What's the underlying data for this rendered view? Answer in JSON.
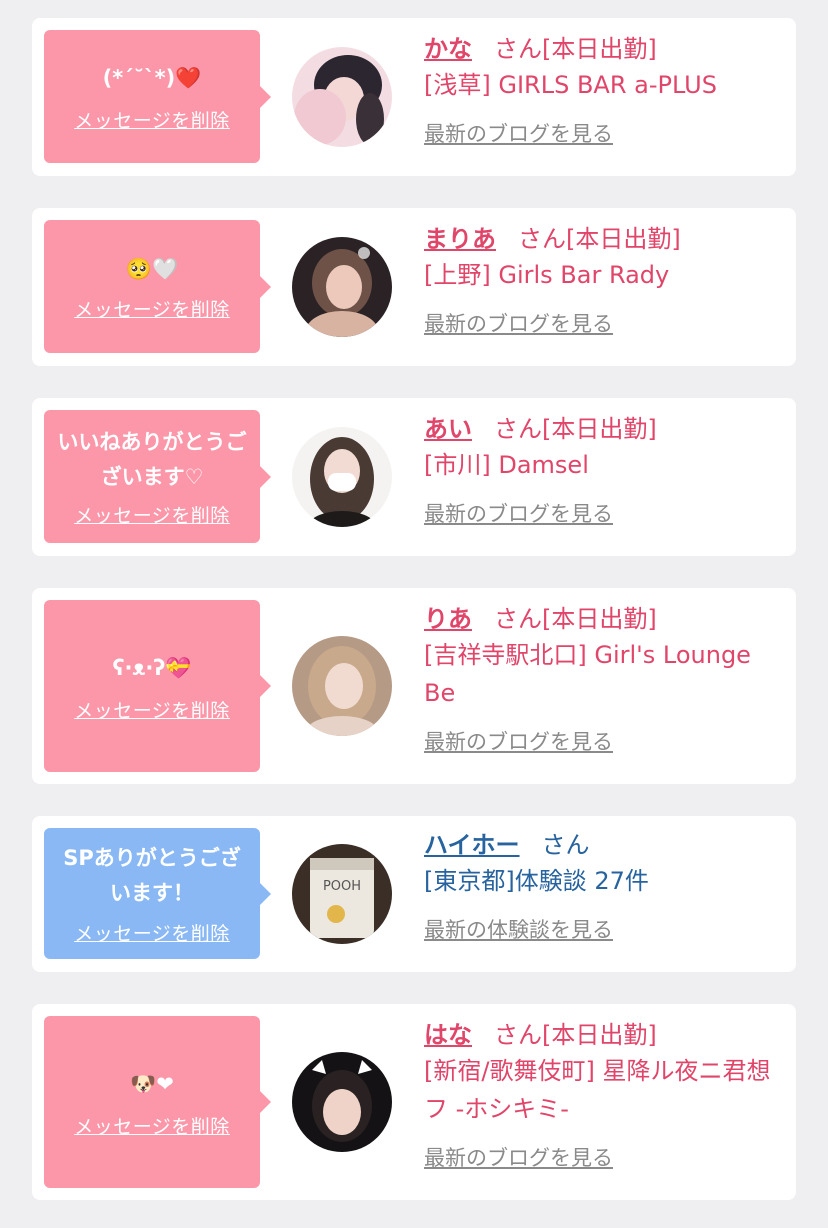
{
  "cards": [
    {
      "message": "(*´˘`*)❤️",
      "delete_label": "メッセージを削除",
      "name": "かな",
      "suffix": "さん[本日出勤]",
      "shop": "[浅草] GIRLS BAR a-PLUS",
      "link": "最新のブログを見る"
    },
    {
      "message": "🥺🤍",
      "delete_label": "メッセージを削除",
      "name": "まりあ",
      "suffix": "さん[本日出勤]",
      "shop": "[上野] Girls Bar Rady",
      "link": "最新のブログを見る"
    },
    {
      "message": "いいねありがとうございます♡",
      "delete_label": "メッセージを削除",
      "name": "あい",
      "suffix": "さん[本日出勤]",
      "shop": "[市川] Damsel",
      "link": "最新のブログを見る"
    },
    {
      "message": "ʕ·ᴥ·ʔ💝",
      "delete_label": "メッセージを削除",
      "name": "りあ",
      "suffix": "さん[本日出勤]",
      "shop": "[吉祥寺駅北口] Girl's Lounge Be",
      "link": "最新のブログを見る"
    },
    {
      "message": "SPありがとうございます！",
      "delete_label": "メッセージを削除",
      "name": "ハイホー",
      "suffix": "さん",
      "shop": "[東京都]体験談 27件",
      "link": "最新の体験談を見る",
      "avatar_text": "POOH"
    },
    {
      "message": "🐶❤",
      "delete_label": "メッセージを削除",
      "name": "はな",
      "suffix": "さん[本日出勤]",
      "shop": "[新宿/歌舞伎町] 星降ル夜ニ君想フ -ホシキミ-",
      "link": "最新のブログを見る"
    }
  ],
  "colors": {
    "page_bg": "#efeff1",
    "card_bg": "#ffffff",
    "pink_bubble": "#fc97a9",
    "blue_bubble": "#8ab8f5",
    "pink_text": "#e0456a",
    "blue_text": "#27639e",
    "link_gray": "#8a8a8a"
  }
}
